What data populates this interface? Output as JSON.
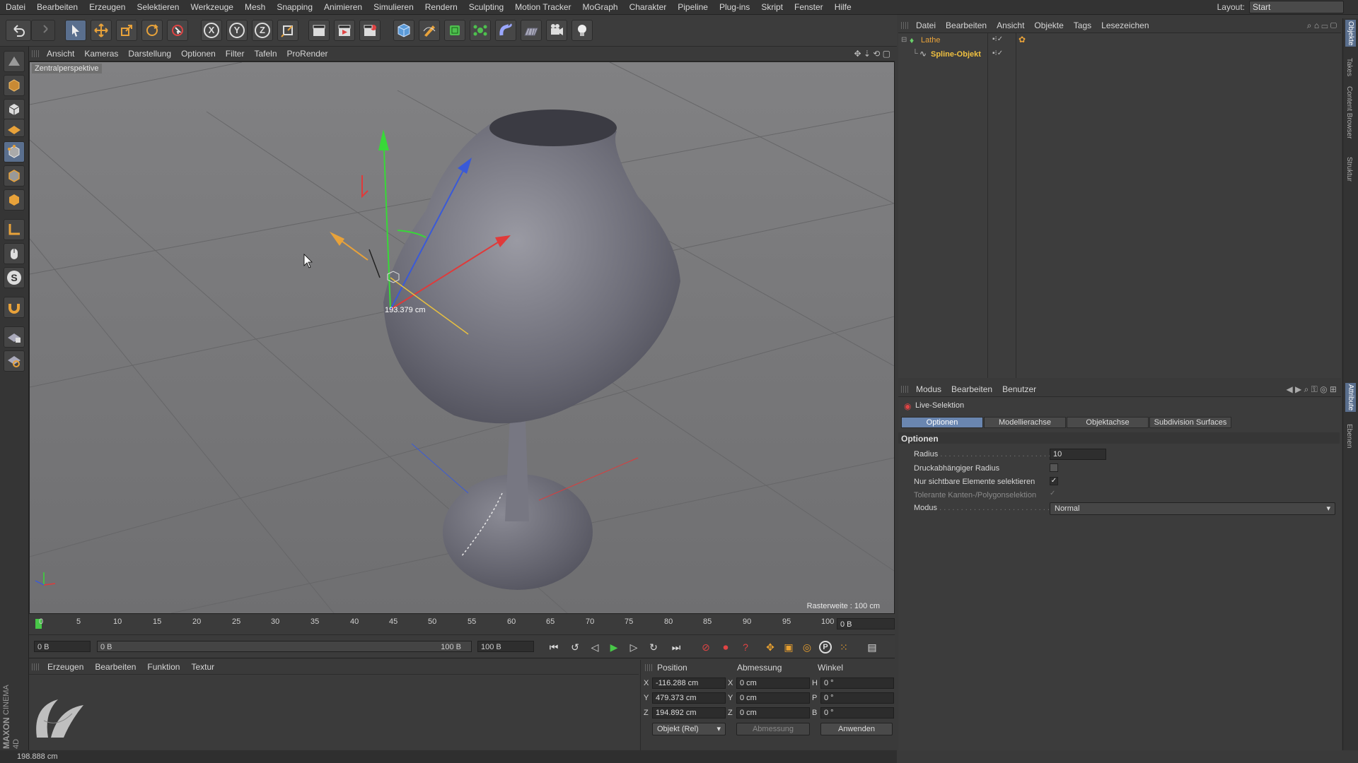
{
  "menubar": {
    "items": [
      "Datei",
      "Bearbeiten",
      "Erzeugen",
      "Selektieren",
      "Werkzeuge",
      "Mesh",
      "Snapping",
      "Animieren",
      "Simulieren",
      "Rendern",
      "Sculpting",
      "Motion Tracker",
      "MoGraph",
      "Charakter",
      "Pipeline",
      "Plug-ins",
      "Skript",
      "Fenster",
      "Hilfe"
    ],
    "layout_label": "Layout:",
    "layout_value": "Start"
  },
  "toolbar": {
    "axis_x": "X",
    "axis_y": "Y",
    "axis_z": "Z"
  },
  "viewport": {
    "menu": [
      "Ansicht",
      "Kameras",
      "Darstellung",
      "Optionen",
      "Filter",
      "Tafeln",
      "ProRender"
    ],
    "camera_label": "Zentralperspektive",
    "measurement": "193.379 cm",
    "grid_label": "Rasterweite : 100 cm"
  },
  "timeline": {
    "ticks": [
      "0",
      "5",
      "10",
      "15",
      "20",
      "25",
      "30",
      "35",
      "40",
      "45",
      "50",
      "55",
      "60",
      "65",
      "70",
      "75",
      "80",
      "85",
      "90",
      "95",
      "100"
    ],
    "current_frame": "0 B"
  },
  "transport": {
    "start_field": "0 B",
    "range_start": "0 B",
    "range_end": "100 B",
    "end_field": "100 B"
  },
  "material_panel": {
    "menu": [
      "Erzeugen",
      "Bearbeiten",
      "Funktion",
      "Textur"
    ],
    "brand_line1": "MAXON",
    "brand_line2": "CINEMA 4D"
  },
  "coordinates": {
    "headers": {
      "position": "Position",
      "size": "Abmessung",
      "rotation": "Winkel"
    },
    "rows": [
      {
        "axis": "X",
        "position": "-116.288 cm",
        "size_axis": "X",
        "size": "0 cm",
        "rot_axis": "H",
        "rotation": "0 °"
      },
      {
        "axis": "Y",
        "position": "479.373 cm",
        "size_axis": "Y",
        "size": "0 cm",
        "rot_axis": "P",
        "rotation": "0 °"
      },
      {
        "axis": "Z",
        "position": "194.892 cm",
        "size_axis": "Z",
        "size": "0 cm",
        "rot_axis": "B",
        "rotation": "0 °"
      }
    ],
    "mode_select": "Objekt (Rel)",
    "size_select": "Abmessung",
    "apply_button": "Anwenden"
  },
  "status_bar": {
    "text": "198.888 cm"
  },
  "objects_manager": {
    "menu": [
      "Datei",
      "Bearbeiten",
      "Ansicht",
      "Objekte",
      "Tags",
      "Lesezeichen"
    ],
    "objects": [
      {
        "name": "Lathe",
        "color": "#e8a23a"
      },
      {
        "name": "Spline-Objekt",
        "color": "#f0c040"
      }
    ]
  },
  "attributes_manager": {
    "menu": [
      "Modus",
      "Bearbeiten",
      "Benutzer"
    ],
    "tool_name": "Live-Selektion",
    "tabs": [
      "Optionen",
      "Modellierachse",
      "Objektachse",
      "Subdivision Surfaces"
    ],
    "section": "Optionen",
    "radius_label": "Radius",
    "radius_value": "10",
    "pressure_label": "Druckabhängiger Radius",
    "visible_only_label": "Nur sichtbare Elemente selektieren",
    "tolerant_label": "Tolerante Kanten-/Polygonselektion",
    "mode_label": "Modus",
    "mode_value": "Normal"
  },
  "side_tabs": [
    "Objekte",
    "Takes",
    "Content Browser",
    "Struktur",
    "Attribute",
    "Ebenen"
  ],
  "colors": {
    "accent_blue": "#6a86b0",
    "axis_red": "#e03a3a",
    "axis_green": "#38d838",
    "axis_blue": "#3a5ad8",
    "highlight_orange": "#e8a23a"
  }
}
